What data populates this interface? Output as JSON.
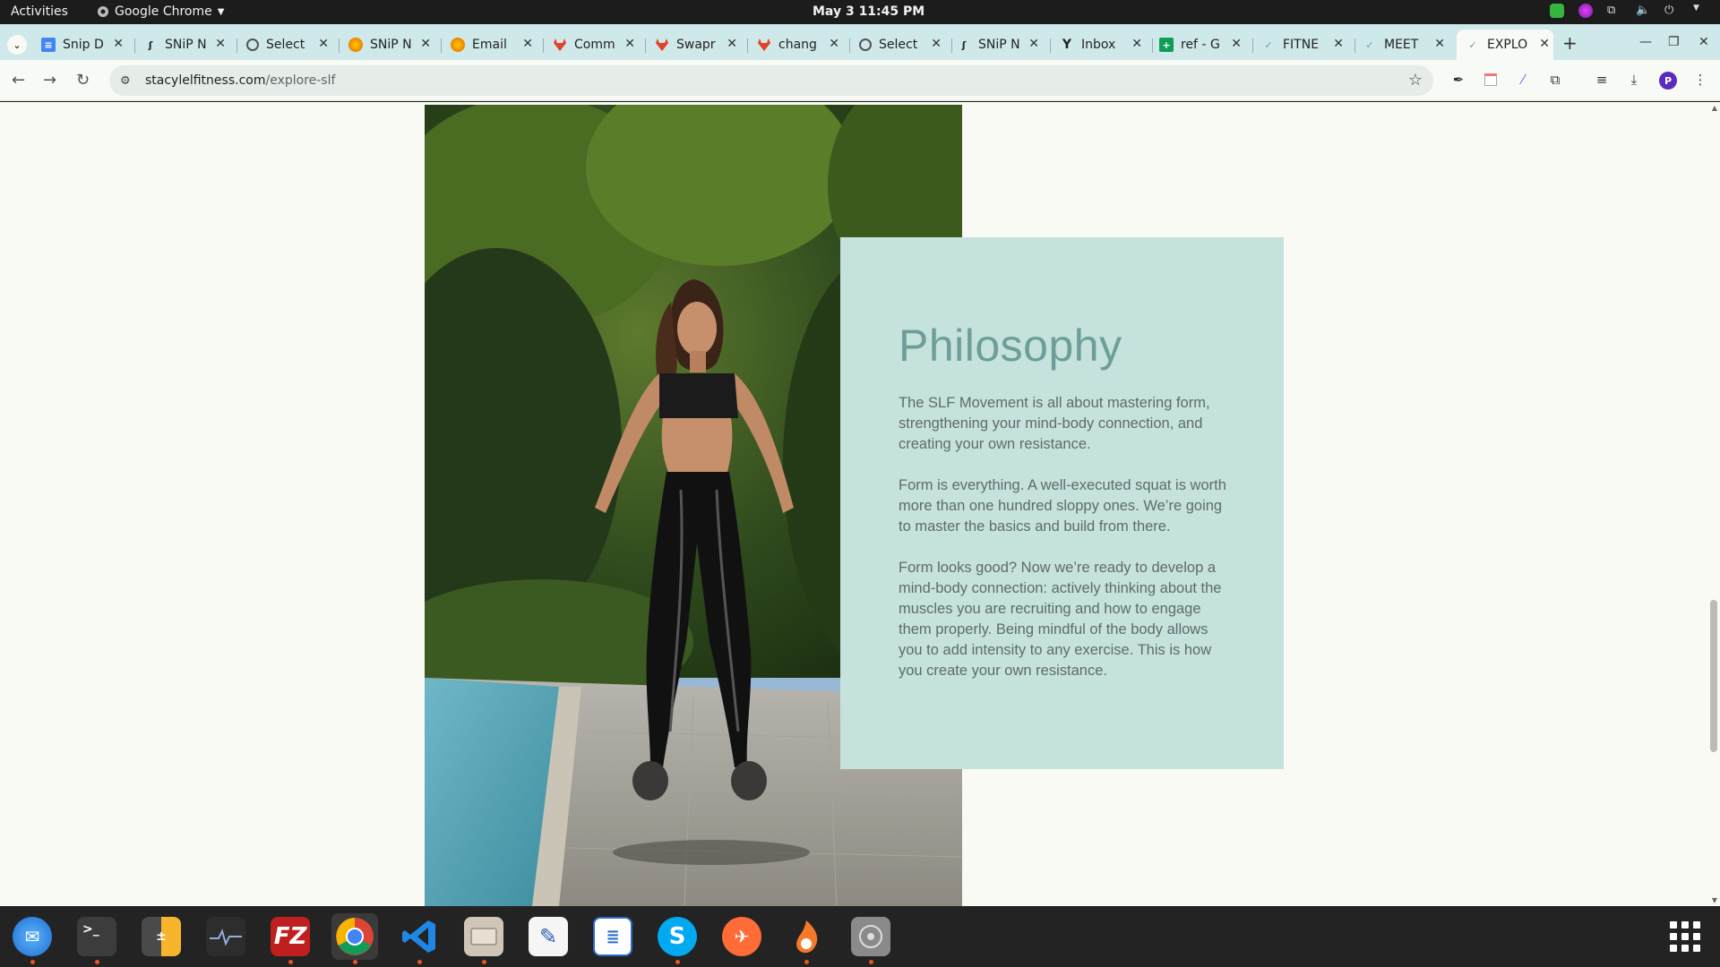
{
  "topbar": {
    "activities": "Activities",
    "app_name": "Google Chrome",
    "clock": "May 3  11:45 PM"
  },
  "tabs": [
    {
      "label": "Snip D",
      "icon": "google-docs-icon"
    },
    {
      "label": "SNiP N",
      "icon": "snip-logo-icon"
    },
    {
      "label": "Select",
      "icon": "globe-icon"
    },
    {
      "label": "SNiP N",
      "icon": "firefox-icon"
    },
    {
      "label": "Email",
      "icon": "firefox-icon"
    },
    {
      "label": "Comm",
      "icon": "gitlab-icon"
    },
    {
      "label": "Swapr",
      "icon": "gitlab-icon"
    },
    {
      "label": "chang",
      "icon": "gitlab-icon"
    },
    {
      "label": "Select",
      "icon": "globe-icon"
    },
    {
      "label": "SNiP N",
      "icon": "snip-logo-icon"
    },
    {
      "label": "Inbox",
      "icon": "yahoo-mail-icon"
    },
    {
      "label": "ref - G",
      "icon": "google-sheets-icon"
    },
    {
      "label": "FITNE",
      "icon": "slf-icon"
    },
    {
      "label": "MEET",
      "icon": "slf-icon"
    },
    {
      "label": "EXPLO",
      "icon": "slf-icon",
      "active": true
    }
  ],
  "toolbar": {
    "url_host": "stacylelfitness.com",
    "url_path": "/explore-slf",
    "profile_initial": "P"
  },
  "page": {
    "title": "Philosophy",
    "paragraphs": [
      "The SLF Movement is all about mastering form, strengthening your mind-body connection, and creating your own resistance.",
      "Form is everything. A well-executed squat is worth more than one hundred sloppy ones. We’re going to master the basics and build from there.",
      "Form looks good? Now we’re ready to develop a mind-body connection: actively thinking about the muscles you are recruiting and how to engage them properly. Being mindful of the body allows you to add intensity to any exercise. This is how you create your own resistance."
    ]
  },
  "colors": {
    "page_bg": "#fafaf4",
    "card_bg": "#c6e2dd",
    "title": "#6d9e99",
    "body_text": "#5e6b6a",
    "tabstrip": "#cfe8ea"
  },
  "dock": [
    {
      "name": "thunderbird-icon",
      "color": "#1b6fd1"
    },
    {
      "name": "terminal-icon",
      "color": "#3c3c3c"
    },
    {
      "name": "calculator-icon",
      "color": "#4a4a4a"
    },
    {
      "name": "system-monitor-icon",
      "color": "#2d2d2d"
    },
    {
      "name": "filezilla-icon",
      "color": "#bf1f1f"
    },
    {
      "name": "chrome-icon",
      "color": "#ffffff",
      "active": true
    },
    {
      "name": "vscode-icon",
      "color": "#1e88e5"
    },
    {
      "name": "files-icon",
      "color": "#cfc6b8"
    },
    {
      "name": "text-editor-icon",
      "color": "#f5f5f5"
    },
    {
      "name": "libreoffice-writer-icon",
      "color": "#ffffff"
    },
    {
      "name": "skype-icon",
      "color": "#00a9f0"
    },
    {
      "name": "postman-icon",
      "color": "#ff6c37"
    },
    {
      "name": "blender-icon",
      "color": "#f5792a"
    },
    {
      "name": "disk-utility-icon",
      "color": "#8a8a8a"
    }
  ]
}
